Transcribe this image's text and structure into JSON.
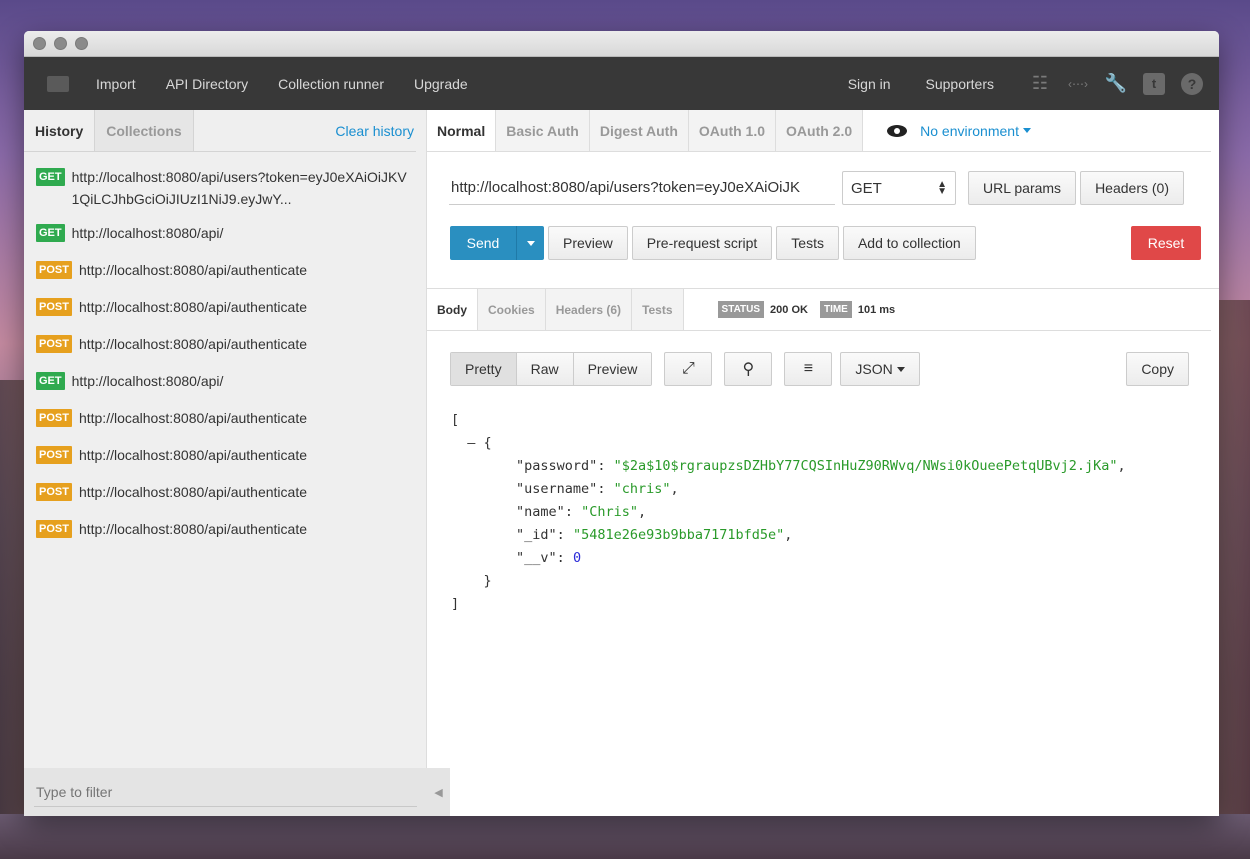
{
  "navbar": {
    "items": [
      "Import",
      "API Directory",
      "Collection runner",
      "Upgrade"
    ],
    "sign_in": "Sign in",
    "supporters": "Supporters"
  },
  "sidebar": {
    "tabs": [
      "History",
      "Collections"
    ],
    "clear_history": "Clear history",
    "history": [
      {
        "method": "GET",
        "url": "http://localhost:8080/api/users?token=eyJ0eXAiOiJKV1QiLCJhbGciOiJIUzI1NiJ9.eyJwY..."
      },
      {
        "method": "GET",
        "url": "http://localhost:8080/api/"
      },
      {
        "method": "POST",
        "url": "http://localhost:8080/api/authenticate"
      },
      {
        "method": "POST",
        "url": "http://localhost:8080/api/authenticate"
      },
      {
        "method": "POST",
        "url": "http://localhost:8080/api/authenticate"
      },
      {
        "method": "GET",
        "url": "http://localhost:8080/api/"
      },
      {
        "method": "POST",
        "url": "http://localhost:8080/api/authenticate"
      },
      {
        "method": "POST",
        "url": "http://localhost:8080/api/authenticate"
      },
      {
        "method": "POST",
        "url": "http://localhost:8080/api/authenticate"
      },
      {
        "method": "POST",
        "url": "http://localhost:8080/api/authenticate"
      }
    ],
    "filter_placeholder": "Type to filter"
  },
  "auth_tabs": [
    "Normal",
    "Basic Auth",
    "Digest Auth",
    "OAuth 1.0",
    "OAuth 2.0"
  ],
  "environment": "No environment",
  "request": {
    "url": "http://localhost:8080/api/users?token=eyJ0eXAiOiJK",
    "method": "GET",
    "url_params_label": "URL params",
    "headers_label": "Headers (0)"
  },
  "actions": {
    "send": "Send",
    "preview": "Preview",
    "prerequest": "Pre-request script",
    "tests": "Tests",
    "add_to_collection": "Add to collection",
    "reset": "Reset"
  },
  "response": {
    "tabs": [
      "Body",
      "Cookies",
      "Headers (6)",
      "Tests"
    ],
    "status_label": "STATUS",
    "status_value": "200 OK",
    "time_label": "TIME",
    "time_value": "101 ms",
    "view_modes": [
      "Pretty",
      "Raw",
      "Preview"
    ],
    "format": "JSON",
    "copy": "Copy",
    "body": {
      "password": "$2a$10$rgraupzsDZHbY77CQSInHuZ90RWvq/NWsi0kOueePetqUBvj2.jKa",
      "username": "chris",
      "name": "Chris",
      "_id": "5481e26e93b9bba7171bfd5e",
      "__v": "0"
    }
  },
  "colors": {
    "get": "#2faa4f",
    "post": "#e6a01e",
    "send": "#2a8fc0",
    "reset": "#e04848",
    "link": "#1a8fd0"
  }
}
